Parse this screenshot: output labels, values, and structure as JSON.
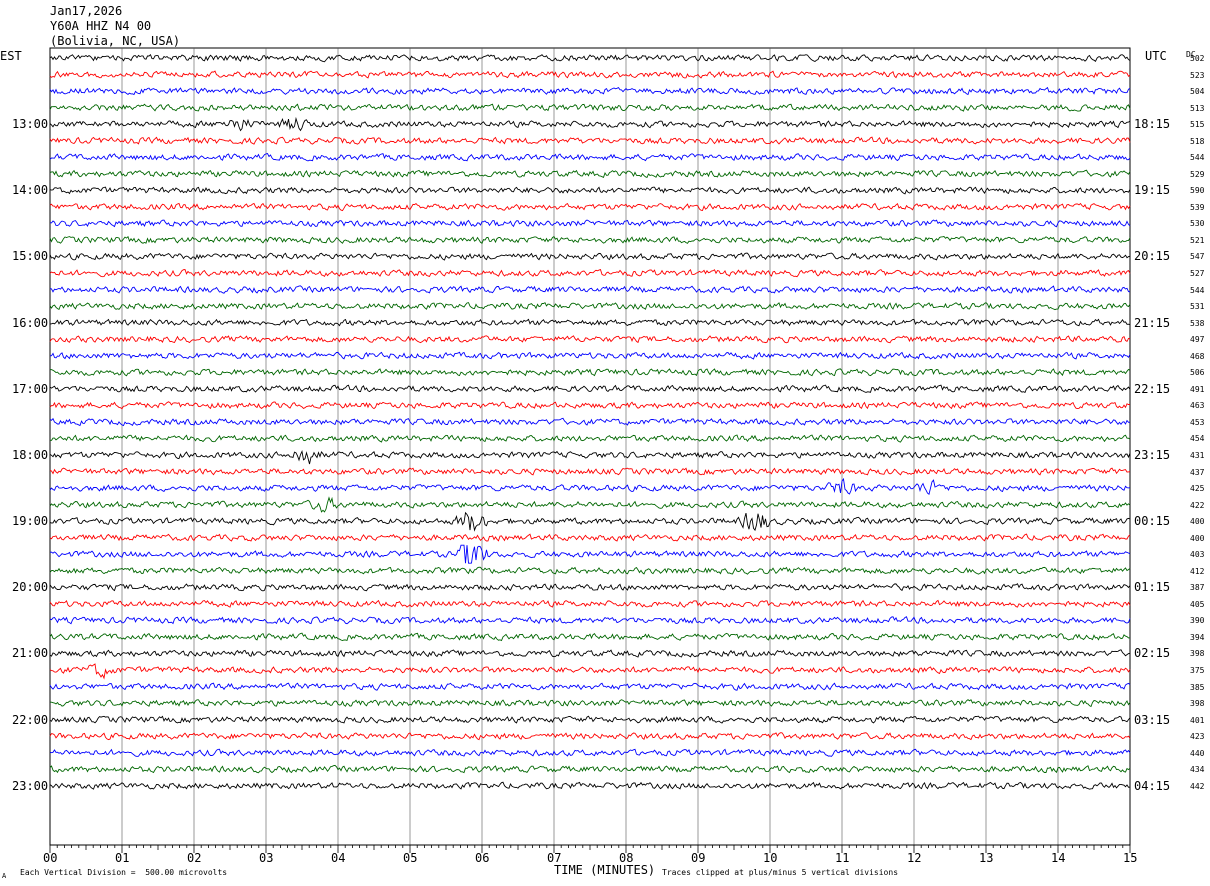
{
  "header": {
    "date": "Jan17,2026",
    "station": "Y60A HHZ N4 00",
    "location": "(Bolivia, NC, USA)"
  },
  "left_axis": {
    "title": "EST",
    "hour_labels": [
      "13:00",
      "14:00",
      "15:00",
      "16:00",
      "17:00",
      "18:00",
      "19:00",
      "20:00",
      "21:00",
      "22:00",
      "23:00"
    ]
  },
  "right_axis": {
    "title": "UTC",
    "dc_title": "DC",
    "hour_labels": [
      "18:15",
      "19:15",
      "20:15",
      "21:15",
      "22:15",
      "23:15",
      "00:15",
      "01:15",
      "02:15",
      "03:15",
      "04:15"
    ],
    "dc_values": [
      "502",
      "523",
      "504",
      "513",
      "515",
      "518",
      "544",
      "529",
      "590",
      "539",
      "530",
      "521",
      "547",
      "527",
      "544",
      "531",
      "538",
      "497",
      "468",
      "506",
      "491",
      "463",
      "453",
      "454",
      "431",
      "437",
      "425",
      "422",
      "400",
      "400",
      "403",
      "412",
      "387",
      "405",
      "390",
      "394",
      "398",
      "375",
      "385",
      "398",
      "401",
      "423",
      "440",
      "434",
      "442"
    ]
  },
  "x_axis": {
    "ticks": [
      "00",
      "01",
      "02",
      "03",
      "04",
      "05",
      "06",
      "07",
      "08",
      "09",
      "10",
      "11",
      "12",
      "13",
      "14",
      "15"
    ],
    "title": "TIME (MINUTES)"
  },
  "footer": {
    "scale_note": "Each Vertical Division =  500.00 microvolts",
    "clip_note": "Traces clipped at plus/minus 5 vertical divisions",
    "corner_mark": "A"
  },
  "trace_colors": [
    "#000000",
    "#ff0000",
    "#0000ff",
    "#006600"
  ],
  "events": [
    {
      "trace": 4,
      "minute": 2.6,
      "amp": 2.0
    },
    {
      "trace": 4,
      "minute": 3.4,
      "amp": 2.0
    },
    {
      "trace": 24,
      "minute": 3.55,
      "amp": 3.0
    },
    {
      "trace": 26,
      "minute": 11.0,
      "amp": 2.5
    },
    {
      "trace": 26,
      "minute": 12.2,
      "amp": 2.0
    },
    {
      "trace": 27,
      "minute": 3.8,
      "amp": 2.0
    },
    {
      "trace": 28,
      "minute": 5.85,
      "amp": 4.5
    },
    {
      "trace": 28,
      "minute": 9.8,
      "amp": 4.0
    },
    {
      "trace": 30,
      "minute": 5.85,
      "amp": 7.0
    },
    {
      "trace": 37,
      "minute": 0.7,
      "amp": 2.0
    }
  ]
}
